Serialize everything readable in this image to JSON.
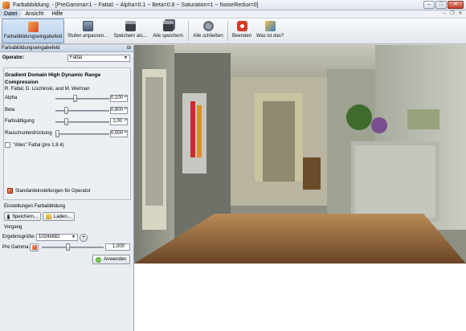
{
  "window": {
    "title": "Farbabbildung: - [PreGamma=1 ~ Fattal: ~ Alpha=0.1 ~ Beta=0.8 ~ Saturation=1 ~ NoiseRedux=0]",
    "min_glyph": "–",
    "max_glyph": "□",
    "close_glyph": "✕"
  },
  "menu": {
    "items": [
      "Datei",
      "Ansicht",
      "Hilfe"
    ],
    "mdi_min": "–",
    "mdi_restore": "❐",
    "mdi_close": "✕"
  },
  "toolbar": {
    "items": [
      {
        "label": "Farbabbildungseingabefeld",
        "icon": "tonemap-panel-icon",
        "color": "#e0622c"
      },
      {
        "label": "Stufen anpassen...",
        "icon": "levels-icon",
        "color": "#5a6f8a"
      },
      {
        "label": "Speichern als...",
        "icon": "save-as-icon",
        "color": "#3a3f46"
      },
      {
        "label": "Alle speichern",
        "icon": "save-all-icon",
        "color": "#3a3f46"
      },
      {
        "label": "Alle schließen",
        "icon": "close-all-icon",
        "color": "#6b7480"
      },
      {
        "label": "Beenden",
        "icon": "quit-icon",
        "color": "#c8321f"
      },
      {
        "label": "Was ist das?",
        "icon": "whats-this-icon",
        "color": "#3a7cc4"
      }
    ]
  },
  "panel": {
    "title": "Farbabbildungseingabefeld",
    "pin_glyph": "⊟",
    "operator_label": "Operator:",
    "operator_value": "Fattal",
    "algorithm_title": "Gradient Domain High Dynamic Range Compression",
    "algorithm_authors": "R. Fattal, D. Lischinski, and M. Werman",
    "sliders": [
      {
        "label": "Alpha",
        "value": "0,100",
        "position": 0.35
      },
      {
        "label": "Beta",
        "value": "0,800",
        "position": 0.18
      },
      {
        "label": "Farbsättigung",
        "value": "1,00",
        "position": 0.18
      },
      {
        "label": "Rauschunterdrückung",
        "value": "0,000",
        "position": 0.0
      }
    ],
    "old_fattal_label": "\"Altes\" Fattal (pre 1.8.4)",
    "reset_button": "Standardeinstellungen für Operator",
    "settings_label": "Einstellungen Farbabbildung",
    "load_settings_button": "Speichern...",
    "load_button": "Laden...",
    "process_label": "Vorgang",
    "result_size_label": "Ergebnisgröße:",
    "result_size_value": "1024x682",
    "add_glyph": "+",
    "pregamma_label": "Pre Gamma:",
    "pregamma_value": "1,000",
    "pregamma_position": 0.42,
    "apply_button": "Anwenden"
  }
}
